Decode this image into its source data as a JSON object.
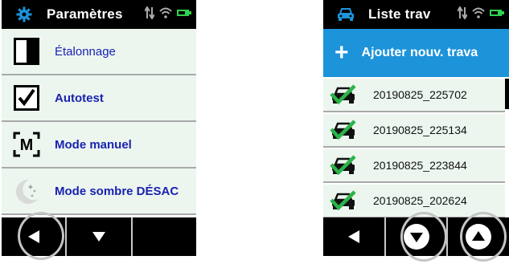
{
  "left_screen": {
    "header": {
      "title": "Paramètres",
      "icon": "gear-icon"
    },
    "status_icons": [
      "transfer-icon",
      "wifi-icon",
      "battery-icon"
    ],
    "menu": [
      {
        "label": "Étalonnage",
        "icon": "calibration-icon"
      },
      {
        "label": "Autotest",
        "icon": "checkbox-icon"
      },
      {
        "label": "Mode manuel",
        "icon": "manual-mode-icon"
      },
      {
        "label": "Mode sombre DÉSAC",
        "icon": "moon-icon"
      }
    ],
    "bottom_buttons": [
      "back-arrow-icon",
      "down-arrow-icon",
      "empty"
    ]
  },
  "right_screen": {
    "header": {
      "title": "Liste trav",
      "icon": "car-icon"
    },
    "status_icons": [
      "transfer-icon",
      "wifi-icon",
      "battery-icon"
    ],
    "add_button": {
      "label": "Ajouter nouv. trava",
      "icon": "plus-icon"
    },
    "jobs": [
      {
        "label": "20190825_225702"
      },
      {
        "label": "20190825_225134"
      },
      {
        "label": "20190825_223844"
      },
      {
        "label": "20190825_202624"
      }
    ],
    "bottom_buttons": [
      "back-arrow-icon",
      "down-arrow-icon",
      "up-arrow-icon"
    ]
  },
  "colors": {
    "accent_blue": "#1d93d9",
    "menu_text": "#1a22b0",
    "menu_bg": "#ecf6ef",
    "check_green": "#2bb34a",
    "battery_green": "#2fd24f"
  }
}
